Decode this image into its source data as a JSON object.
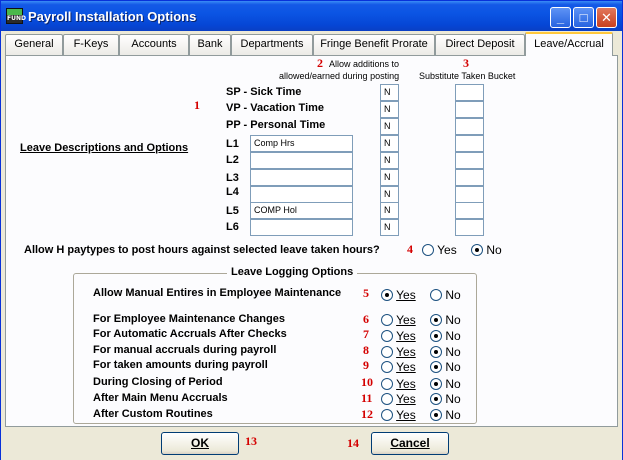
{
  "window": {
    "title": "Payroll Installation Options",
    "icon_text": "FUND"
  },
  "title_buttons": {
    "minimize": "_",
    "maximize": "□",
    "close": "✕"
  },
  "tabs": [
    {
      "label": "General"
    },
    {
      "label": "F-Keys"
    },
    {
      "label": "Accounts"
    },
    {
      "label": "Bank"
    },
    {
      "label": "Departments"
    },
    {
      "label": "Fringe Benefit Prorate"
    },
    {
      "label": "Direct Deposit"
    },
    {
      "label": "Leave/Accrual"
    }
  ],
  "active_tab": "Leave/Accrual",
  "callouts": {
    "n1": "1",
    "n2": "2",
    "n3": "3",
    "n4": "4",
    "n5": "5",
    "n6": "6",
    "n7": "7",
    "n8": "8",
    "n9": "9",
    "n10": "10",
    "n11": "11",
    "n12": "12",
    "n13": "13",
    "n14": "14"
  },
  "headers": {
    "allow_line1": "Allow additions to",
    "allow_line2": "allowed/earned during posting",
    "bucket": "Substitute Taken Bucket"
  },
  "section_label": "Leave Descriptions and Options",
  "fixed_leaves": [
    {
      "code": "SP - Sick Time",
      "allow": "N",
      "bucket": ""
    },
    {
      "code": "VP - Vacation Time",
      "allow": "N",
      "bucket": ""
    },
    {
      "code": "PP - Personal Time",
      "allow": "N",
      "bucket": ""
    }
  ],
  "custom_leaves": [
    {
      "code": "L1",
      "desc": "Comp Hrs",
      "allow": "N",
      "bucket": ""
    },
    {
      "code": "L2",
      "desc": "",
      "allow": "N",
      "bucket": ""
    },
    {
      "code": "L3",
      "desc": "",
      "allow": "N",
      "bucket": ""
    },
    {
      "code": "L4",
      "desc": "",
      "allow": "N",
      "bucket": ""
    },
    {
      "code": "L5",
      "desc": "COMP Hol",
      "allow": "N",
      "bucket": ""
    },
    {
      "code": "L6",
      "desc": "",
      "allow": "N",
      "bucket": ""
    }
  ],
  "h_paytypes": {
    "question": "Allow H paytypes to post hours against selected leave taken hours?",
    "yes": "Yes",
    "no": "No",
    "selected": "No"
  },
  "logging": {
    "title": "Leave Logging Options",
    "yes": "Yes",
    "no": "No",
    "options": [
      {
        "label": "Allow Manual Entires in Employee Maintenance",
        "selected": "Yes"
      },
      {
        "label": "For Employee Maintenance Changes",
        "selected": "No"
      },
      {
        "label": "For Automatic Accruals After Checks",
        "selected": "No"
      },
      {
        "label": "For manual accruals during payroll",
        "selected": "No"
      },
      {
        "label": "For taken amounts during payroll",
        "selected": "No"
      },
      {
        "label": "During Closing of Period",
        "selected": "No"
      },
      {
        "label": "After Main Menu Accruals",
        "selected": "No"
      },
      {
        "label": "After Custom Routines",
        "selected": "No"
      }
    ]
  },
  "footer": {
    "ok": "OK",
    "cancel": "Cancel"
  },
  "colors": {
    "title_bar": "#0a52e0",
    "callout": "#d40000",
    "tab_highlight": "#ffc83c"
  }
}
